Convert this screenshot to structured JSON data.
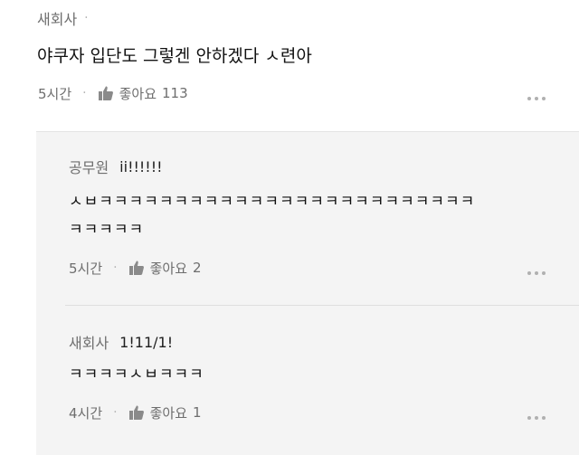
{
  "comments": [
    {
      "author": "새회사",
      "author_suffix": "·",
      "text": "야쿠자 입단도 그렇겐 안하겠다 ㅅ련아",
      "time": "5시간",
      "like_label": "좋아요",
      "like_count": "113"
    }
  ],
  "replies": [
    {
      "author": "공무원",
      "tag": "ii!!!!!!",
      "text_lines": [
        "ㅅㅂㅋㅋㅋㅋㅋㅋㅋㅋㅋㅋㅋㅋㅋㅋㅋㅋㅋㅋㅋㅋㅋㅋㅋㅋㅋ",
        "ㅋㅋㅋㅋㅋ"
      ],
      "time": "5시간",
      "like_label": "좋아요",
      "like_count": "2"
    },
    {
      "author": "새회사",
      "tag": "1!11/1!",
      "text_lines": [
        "ㅋㅋㅋㅋㅅㅂㅋㅋㅋ"
      ],
      "time": "4시간",
      "like_label": "좋아요",
      "like_count": "1"
    }
  ],
  "icons": {
    "thumb": "thumbs-up-icon",
    "more": "more-options-icon"
  },
  "colors": {
    "reply_background": "#f4f4f4",
    "meta_text": "#6e6e6e"
  }
}
